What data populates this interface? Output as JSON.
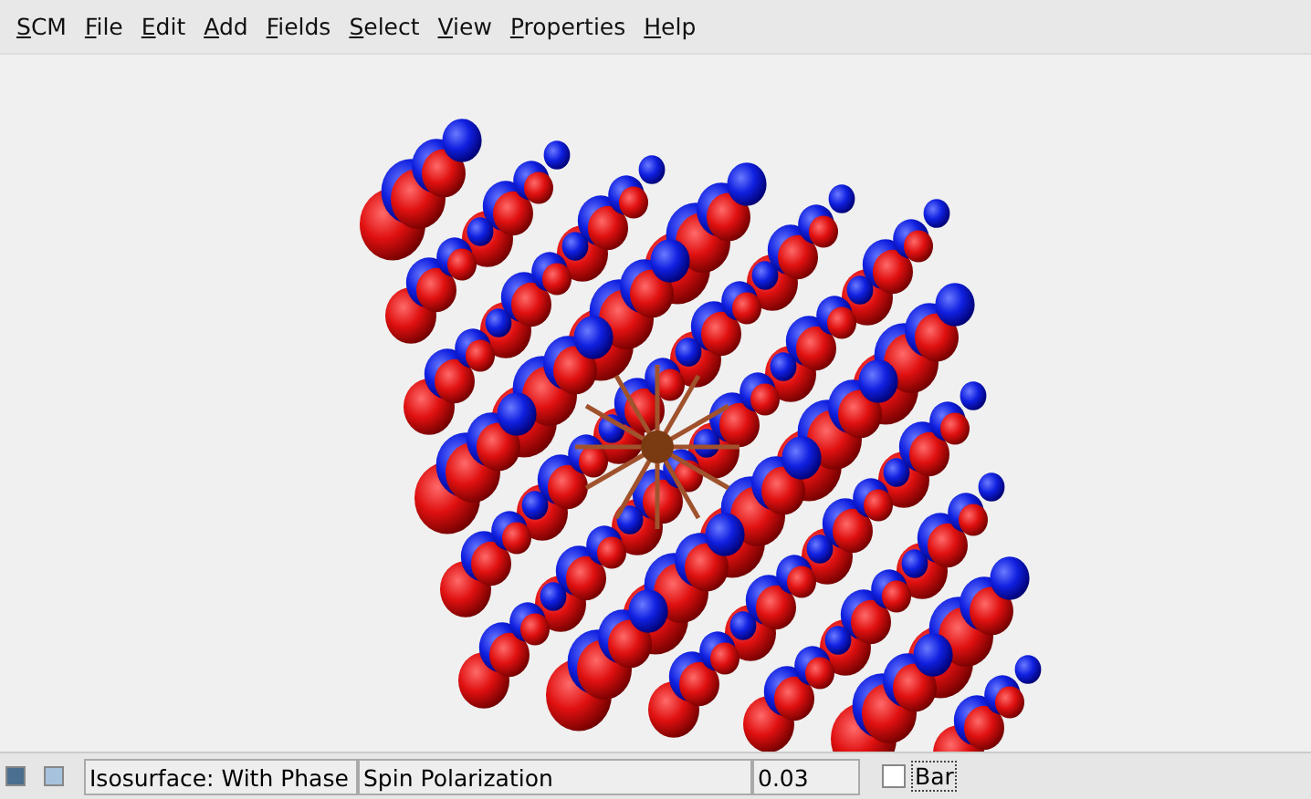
{
  "menu": [
    {
      "label": "SCM"
    },
    {
      "label": "File"
    },
    {
      "label": "Edit"
    },
    {
      "label": "Add"
    },
    {
      "label": "Fields"
    },
    {
      "label": "Select"
    },
    {
      "label": "View"
    },
    {
      "label": "Properties"
    },
    {
      "label": "Help"
    }
  ],
  "status_bar": {
    "mode": "Isosurface: With Phase",
    "field": "Spin Polarization",
    "value": "0.03",
    "bar_checkbox": {
      "label": "Bar",
      "checked": false
    }
  }
}
